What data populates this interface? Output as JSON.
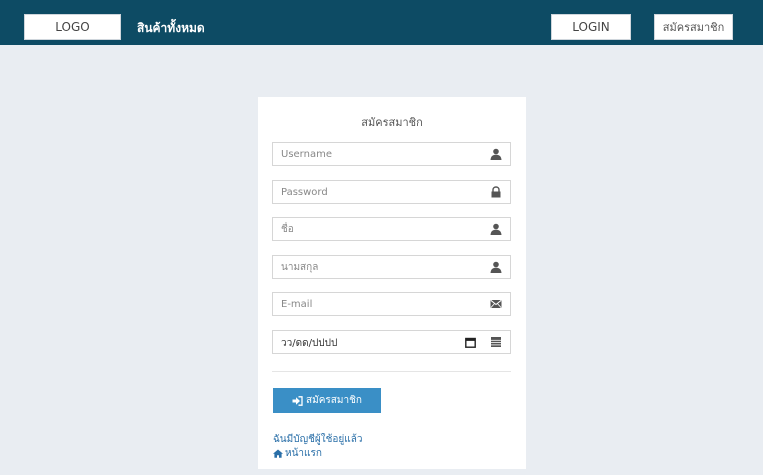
{
  "header": {
    "logo_label": "LOGO",
    "nav_all_products": "สินค้าทั้งหมด",
    "login_label": "LOGIN",
    "register_label": "สมัครสมาชิก",
    "bar_color": "#0d4b64"
  },
  "form": {
    "title": "สมัครสมาชิก",
    "fields": {
      "username_placeholder": "Username",
      "password_placeholder": "Password",
      "firstname_placeholder": "ชื่อ",
      "lastname_placeholder": "นามสกุล",
      "email_placeholder": "E-mail",
      "date_value": "วว/ดด/ปปปป"
    },
    "icons": {
      "username": "user-icon",
      "password": "lock-icon",
      "firstname": "user-icon",
      "lastname": "user-icon",
      "email": "envelope-icon",
      "date_picker": "calendar-icon",
      "date_addon": "calendar-grid-icon"
    },
    "submit_label": "สมัครสมาชิก",
    "submit_color": "#3a8fc6",
    "have_account_link": "ฉันมีบัญชีผู้ใช้อยู่แล้ว",
    "home_link": "หน้าแรก"
  }
}
